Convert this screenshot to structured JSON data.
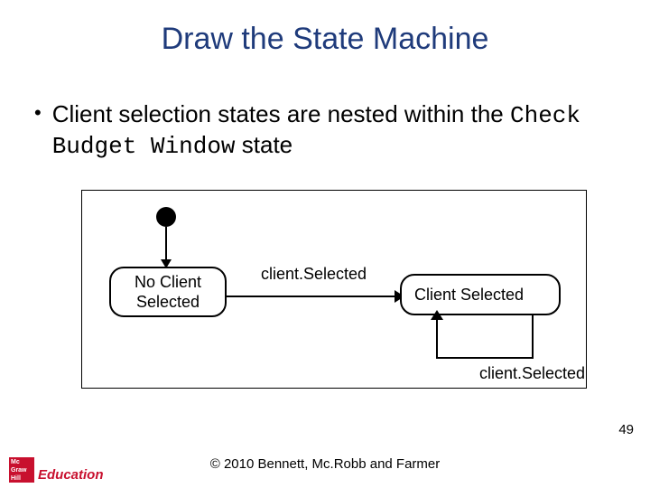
{
  "title": "Draw the State Machine",
  "bullet": {
    "prefix": "Client selection states are nested within the ",
    "code": "Check Budget Window",
    "suffix": " state"
  },
  "diagram": {
    "state_no_client": "No Client Selected",
    "state_client": "Client Selected",
    "transition_label": "client.Selected",
    "self_transition_label": "client.Selected"
  },
  "footer": {
    "copyright": "© 2010 Bennett, Mc.Robb and Farmer",
    "slide_number": "49",
    "logo_lines": "Mc Graw Hill",
    "logo_word": "Education"
  },
  "chart_data": {
    "type": "state-machine",
    "container_state": "Check Budget Window",
    "initial_state": "No Client Selected",
    "states": [
      "No Client Selected",
      "Client Selected"
    ],
    "transitions": [
      {
        "from": "INITIAL",
        "to": "No Client Selected",
        "event": ""
      },
      {
        "from": "No Client Selected",
        "to": "Client Selected",
        "event": "client.Selected"
      },
      {
        "from": "Client Selected",
        "to": "Client Selected",
        "event": "client.Selected"
      }
    ]
  }
}
